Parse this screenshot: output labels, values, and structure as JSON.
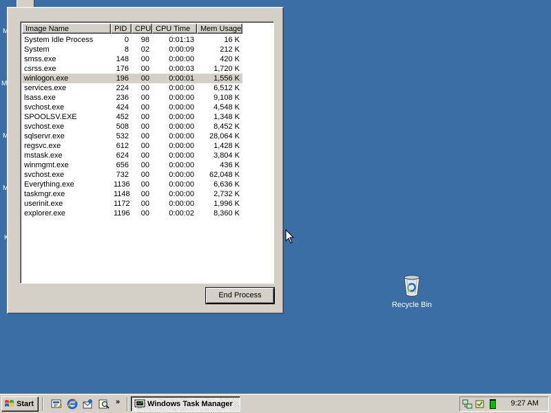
{
  "desktop": {
    "fragments": [
      "M",
      "M",
      "M",
      "M",
      "K"
    ],
    "background_color": "#3a6ea5",
    "recycle_bin_label": "Recycle Bin"
  },
  "task_manager": {
    "columns": [
      {
        "key": "name",
        "label": "Image Name",
        "align": "left"
      },
      {
        "key": "pid",
        "label": "PID",
        "align": "right"
      },
      {
        "key": "cpu",
        "label": "CPU",
        "align": "right"
      },
      {
        "key": "time",
        "label": "CPU Time",
        "align": "right"
      },
      {
        "key": "mem",
        "label": "Mem Usage",
        "align": "right"
      }
    ],
    "processes": [
      {
        "name": "System Idle Process",
        "pid": "0",
        "cpu": "98",
        "time": "0:01:13",
        "mem": "16 K"
      },
      {
        "name": "System",
        "pid": "8",
        "cpu": "02",
        "time": "0:00:09",
        "mem": "212 K"
      },
      {
        "name": "smss.exe",
        "pid": "148",
        "cpu": "00",
        "time": "0:00:00",
        "mem": "420 K"
      },
      {
        "name": "csrss.exe",
        "pid": "176",
        "cpu": "00",
        "time": "0:00:03",
        "mem": "1,720 K"
      },
      {
        "name": "winlogon.exe",
        "pid": "196",
        "cpu": "00",
        "time": "0:00:01",
        "mem": "1,556 K"
      },
      {
        "name": "services.exe",
        "pid": "224",
        "cpu": "00",
        "time": "0:00:00",
        "mem": "6,512 K"
      },
      {
        "name": "lsass.exe",
        "pid": "236",
        "cpu": "00",
        "time": "0:00:00",
        "mem": "9,108 K"
      },
      {
        "name": "svchost.exe",
        "pid": "424",
        "cpu": "00",
        "time": "0:00:00",
        "mem": "4,548 K"
      },
      {
        "name": "SPOOLSV.EXE",
        "pid": "452",
        "cpu": "00",
        "time": "0:00:00",
        "mem": "1,348 K"
      },
      {
        "name": "svchost.exe",
        "pid": "508",
        "cpu": "00",
        "time": "0:00:00",
        "mem": "8,452 K"
      },
      {
        "name": "sqlservr.exe",
        "pid": "532",
        "cpu": "00",
        "time": "0:00:00",
        "mem": "28,064 K"
      },
      {
        "name": "regsvc.exe",
        "pid": "612",
        "cpu": "00",
        "time": "0:00:00",
        "mem": "1,428 K"
      },
      {
        "name": "mstask.exe",
        "pid": "624",
        "cpu": "00",
        "time": "0:00:00",
        "mem": "3,804 K"
      },
      {
        "name": "winmgmt.exe",
        "pid": "656",
        "cpu": "00",
        "time": "0:00:00",
        "mem": "436 K"
      },
      {
        "name": "svchost.exe",
        "pid": "732",
        "cpu": "00",
        "time": "0:00:00",
        "mem": "62,048 K"
      },
      {
        "name": "Everything.exe",
        "pid": "1136",
        "cpu": "00",
        "time": "0:00:00",
        "mem": "6,636 K"
      },
      {
        "name": "taskmgr.exe",
        "pid": "1148",
        "cpu": "00",
        "time": "0:00:00",
        "mem": "2,732 K"
      },
      {
        "name": "userinit.exe",
        "pid": "1172",
        "cpu": "00",
        "time": "0:00:00",
        "mem": "1,996 K"
      },
      {
        "name": "explorer.exe",
        "pid": "1196",
        "cpu": "00",
        "time": "0:00:02",
        "mem": "8,360 K"
      }
    ],
    "selected_index": 4,
    "end_process_label": "End Process"
  },
  "taskbar": {
    "start_label": "Start",
    "quick_launch": [
      "show-desktop-icon",
      "internet-explorer-icon",
      "outlook-express-icon",
      "search-icon"
    ],
    "more_label": "»",
    "task_button_label": "Windows Task Manager",
    "tray_icons": [
      "network-icon",
      "volume-icon",
      "task-manager-cpu-icon"
    ],
    "clock": "9:27 AM"
  }
}
